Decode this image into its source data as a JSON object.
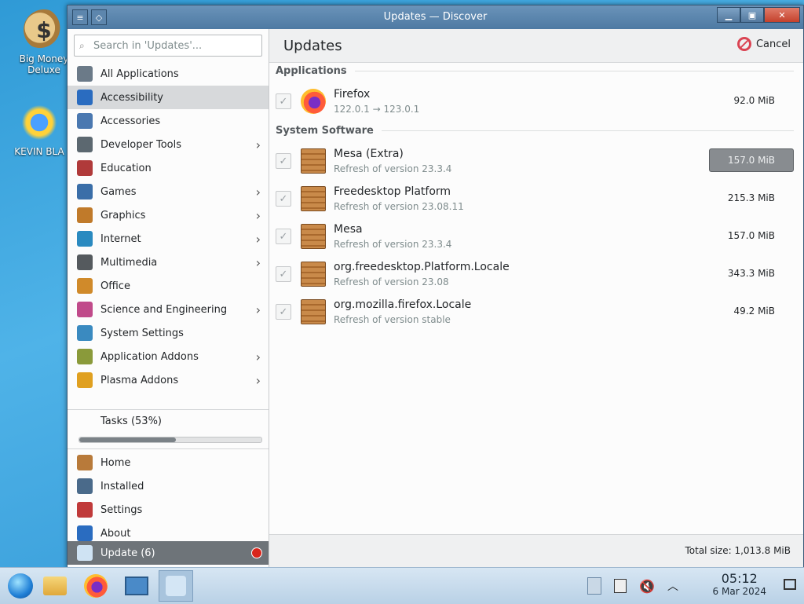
{
  "desktop": {
    "icons": [
      {
        "label_line1": "Big Money",
        "label_line2": "Deluxe"
      },
      {
        "label_line1": "KEVIN BLA"
      }
    ]
  },
  "window": {
    "title": "Updates — Discover"
  },
  "sidebar": {
    "search_placeholder": "Search in 'Updates'...",
    "categories": [
      {
        "label": "All Applications",
        "icon": "grid-icon",
        "color": "#6b7a88",
        "has_submenu": false
      },
      {
        "label": "Accessibility",
        "icon": "accessibility-icon",
        "color": "#2a6cc0",
        "has_submenu": false,
        "active": true
      },
      {
        "label": "Accessories",
        "icon": "accessories-icon",
        "color": "#4a78b0",
        "has_submenu": false
      },
      {
        "label": "Developer Tools",
        "icon": "developer-tools-icon",
        "color": "#5c6870",
        "has_submenu": true
      },
      {
        "label": "Education",
        "icon": "education-icon",
        "color": "#b03a3a",
        "has_submenu": false
      },
      {
        "label": "Games",
        "icon": "games-icon",
        "color": "#3a6ea8",
        "has_submenu": true
      },
      {
        "label": "Graphics",
        "icon": "graphics-icon",
        "color": "#c07a2a",
        "has_submenu": true
      },
      {
        "label": "Internet",
        "icon": "internet-icon",
        "color": "#2a8ac0",
        "has_submenu": true
      },
      {
        "label": "Multimedia",
        "icon": "multimedia-icon",
        "color": "#555a5e",
        "has_submenu": true
      },
      {
        "label": "Office",
        "icon": "office-icon",
        "color": "#d08a2a",
        "has_submenu": false
      },
      {
        "label": "Science and Engineering",
        "icon": "science-icon",
        "color": "#c04a8a",
        "has_submenu": true
      },
      {
        "label": "System Settings",
        "icon": "system-settings-icon",
        "color": "#3a8ac0",
        "has_submenu": false
      },
      {
        "label": "Application Addons",
        "icon": "application-addons-icon",
        "color": "#8a9a3a",
        "has_submenu": true
      },
      {
        "label": "Plasma Addons",
        "icon": "plasma-addons-icon",
        "color": "#e0a020",
        "has_submenu": true
      }
    ],
    "tasks_label": "Tasks (53%)",
    "tasks_progress": 0.53,
    "bottom": [
      {
        "label": "Home",
        "icon": "home-icon",
        "color": "#b87a3a"
      },
      {
        "label": "Installed",
        "icon": "installed-icon",
        "color": "#4a6a8a"
      },
      {
        "label": "Settings",
        "icon": "settings-icon",
        "color": "#c03a3a"
      },
      {
        "label": "About",
        "icon": "about-icon",
        "color": "#2a6cc0"
      }
    ],
    "update_label": "Update (6)"
  },
  "main": {
    "title": "Updates",
    "cancel_label": "Cancel",
    "sections": [
      {
        "heading": "Applications",
        "items": [
          {
            "name": "Firefox",
            "sub": "122.0.1 → 123.0.1",
            "size": "92.0 MiB",
            "icon": "firefox-icon"
          }
        ]
      },
      {
        "heading": "System Software",
        "items": [
          {
            "name": "Mesa (Extra)",
            "sub": "Refresh of version 23.3.4",
            "size": "157.0 MiB",
            "icon": "package-icon",
            "highlight": true
          },
          {
            "name": "Freedesktop Platform",
            "sub": "Refresh of version 23.08.11",
            "size": "215.3 MiB",
            "icon": "package-icon"
          },
          {
            "name": "Mesa",
            "sub": "Refresh of version 23.3.4",
            "size": "157.0 MiB",
            "icon": "package-icon"
          },
          {
            "name": "org.freedesktop.Platform.Locale",
            "sub": "Refresh of version 23.08",
            "size": "343.3 MiB",
            "icon": "package-icon"
          },
          {
            "name": "org.mozilla.firefox.Locale",
            "sub": "Refresh of version stable",
            "size": "49.2 MiB",
            "icon": "package-icon"
          }
        ]
      }
    ],
    "total": "Total size: 1,013.8 MiB"
  },
  "taskbar": {
    "time": "05:12",
    "date": "6 Mar 2024"
  }
}
